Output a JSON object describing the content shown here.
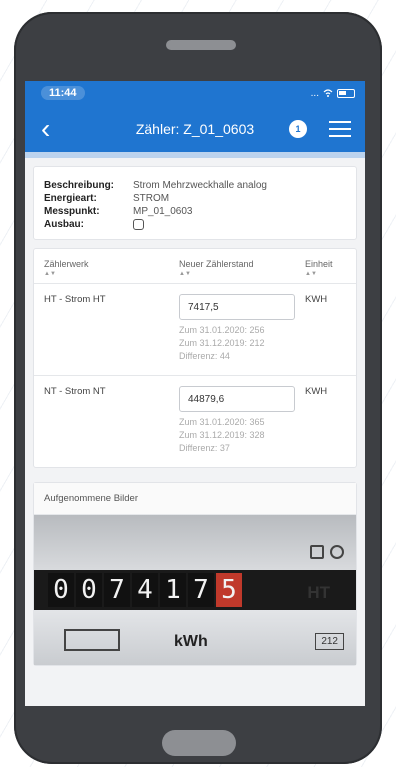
{
  "status": {
    "time": "11:44",
    "signal": "...",
    "wifi": "wifi-icon",
    "battery": "battery-icon"
  },
  "header": {
    "title": "Zähler: Z_01_0603",
    "badge": "1",
    "back": "back-icon",
    "menu": "menu-icon"
  },
  "colors": {
    "primary": "#1f75d0",
    "meter_red": "#c0392b"
  },
  "info": {
    "rows": [
      {
        "label": "Beschreibung:",
        "value": "Strom Mehrzweckhalle analog"
      },
      {
        "label": "Energieart:",
        "value": "STROM"
      },
      {
        "label": "Messpunkt:",
        "value": "MP_01_0603"
      },
      {
        "label": "Ausbau:",
        "value": ""
      }
    ]
  },
  "table": {
    "headers": [
      "Zählerwerk",
      "Neuer Zählerstand",
      "Einheit"
    ],
    "rows": [
      {
        "werk": "HT - Strom HT",
        "value": "7417,5",
        "hint1": "Zum 31.01.2020: 256",
        "hint2": "Zum 31.12.2019: 212",
        "hint3": "Differenz: 44",
        "unit": "KWH"
      },
      {
        "werk": "NT - Strom NT",
        "value": "44879,6",
        "hint1": "Zum 31.01.2020: 365",
        "hint2": "Zum 31.12.2019: 328",
        "hint3": "Differenz: 37",
        "unit": "KWH"
      }
    ]
  },
  "photos": {
    "title": "Aufgenommene Bilder",
    "meter_digits": [
      "0",
      "0",
      "7",
      "4",
      "1",
      "7",
      "5"
    ],
    "meter_label": "HT",
    "meter_unit": "kWh",
    "meter_number": "212"
  }
}
